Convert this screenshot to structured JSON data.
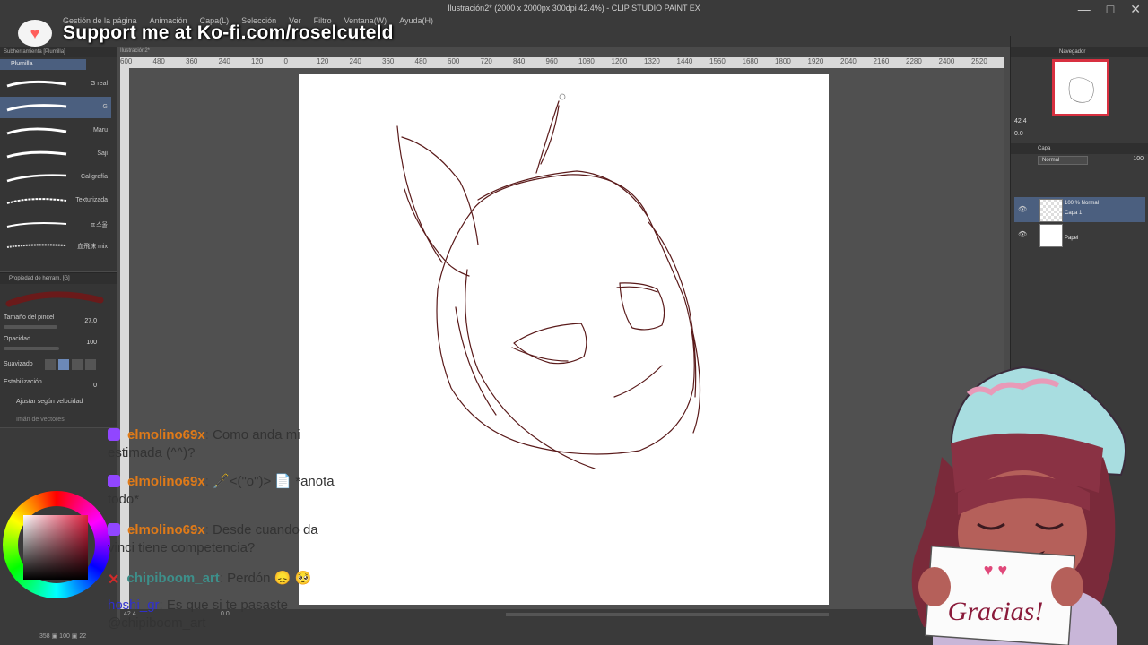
{
  "app": {
    "title": "Ilustración2* (2000 x 2000px 300dpi 42.4%) - CLIP STUDIO PAINT EX",
    "menu": [
      "Gestión de la página",
      "Animación",
      "Capa(L)",
      "Selección",
      "Ver",
      "Filtro",
      "Ventana(W)",
      "Ayuda(H)"
    ],
    "window_controls": [
      "—",
      "□",
      "✕"
    ]
  },
  "banner": {
    "text": "Support me at Ko-fi.com/roselcuteld",
    "cup_color": "#ff5e5b"
  },
  "canvas": {
    "tab": "Ilustración2*",
    "ruler_ticks": [
      "600",
      "480",
      "360",
      "240",
      "120",
      "0",
      "120",
      "240",
      "360",
      "480",
      "600",
      "720",
      "840",
      "960",
      "1080",
      "1200",
      "1320",
      "1440",
      "1560",
      "1680",
      "1800",
      "1920",
      "2040",
      "2160",
      "2280",
      "2400",
      "2520"
    ]
  },
  "subtool": {
    "header": "Subherramienta [Plumilla]",
    "tab": "Plumilla",
    "brushes": [
      {
        "label": "G real",
        "selected": false
      },
      {
        "label": "G",
        "selected": true
      },
      {
        "label": "Maru",
        "selected": false
      },
      {
        "label": "Saji",
        "selected": false
      },
      {
        "label": "Caligrafía",
        "selected": false
      },
      {
        "label": "Texturizada",
        "selected": false
      },
      {
        "label": "ㅍ스울",
        "selected": false
      },
      {
        "label": "血飛沫 mix",
        "selected": false
      }
    ]
  },
  "toolprop": {
    "header": "Propiedad de herram. [G]",
    "brush_size_label": "Tamaño del pincel",
    "brush_size_value": "27.0",
    "opacity_label": "Opacidad",
    "opacity_value": "100",
    "smoothing_label": "Suavizado",
    "stabilization_label": "Estabilización",
    "stabilization_value": "0",
    "speed_label": "Ajustar según velocidad",
    "vector_label": "Imán de vectores"
  },
  "navigator": {
    "header": "Navegador",
    "zoom": "42.4",
    "rotation": "0.0"
  },
  "layers": {
    "header": "Capa",
    "blend_mode": "Normal",
    "opacity": "100",
    "items": [
      {
        "line1": "100 % Normal",
        "line2": "Capa 1",
        "selected": true
      },
      {
        "line1": "",
        "line2": "Papel",
        "selected": false
      }
    ]
  },
  "status": {
    "zoom": "42.4",
    "rotation": "0.0",
    "coords": "358 ▣ 100 ▣ 22"
  },
  "chat": {
    "messages": [
      {
        "user": "elmolino69x",
        "text": "Como anda mi",
        "cont": "estimada (^^)?",
        "badge": "sub"
      },
      {
        "user": "elmolino69x",
        "text": "🖋️<(\"o\")> 📄 *anota",
        "cont": "todo*",
        "badge": "sub"
      },
      {
        "user": "elmolino69x",
        "text": "Desde cuando da",
        "cont": "vinci tiene competencia?",
        "badge": "sub"
      },
      {
        "user": "chipiboom_art",
        "text": "Perdón 😞 🥺",
        "cont": "",
        "badge": "x"
      },
      {
        "user": "hoshi_gr",
        "text": "Es que si te pasaste",
        "cont": "@chipiboom_art",
        "badge": ""
      }
    ]
  },
  "avatar": {
    "sign_text": "Gracias!"
  },
  "colors": {
    "accent_selected": "#4b5f7f",
    "sketch_line": "#5a1a1a",
    "nav_frame": "#d83040"
  }
}
